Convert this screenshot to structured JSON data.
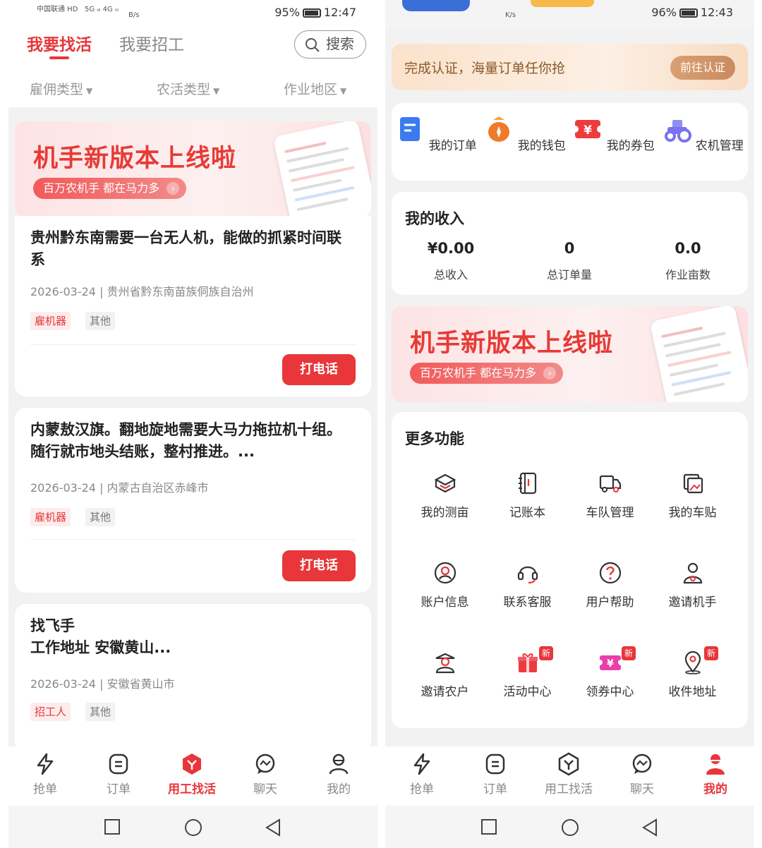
{
  "left": {
    "status": {
      "carrier": "中国联通 HD",
      "signal": "5G ᵢₗₗ 4G ᵢₗₗ",
      "speed": "B/s",
      "battery": "95%",
      "time": "12:47"
    },
    "tabs": {
      "find_work": "我要找活",
      "hire": "我要招工"
    },
    "search_label": "搜索",
    "filters": [
      "雇佣类型",
      "农活类型",
      "作业地区"
    ],
    "banner": {
      "title": "机手新版本上线啦",
      "subtitle": "百万农机手 都在马力多"
    },
    "jobs": [
      {
        "title": "贵州黔东南需要一台无人机，能做的抓紧时间联系",
        "meta": "2026-03-24 | 贵州省黔东南苗族侗族自治州",
        "tag1": "雇机器",
        "tag2": "其他",
        "action": "打电话"
      },
      {
        "title": "内蒙敖汉旗。翻地旋地需要大马力拖拉机十组。随行就市地头结账，整村推进。...",
        "meta": "2026-03-24 | 内蒙古自治区赤峰市",
        "tag1": "雇机器",
        "tag2": "其他",
        "action": "打电话"
      },
      {
        "title": "找飞手\n工作地址 安徽黄山...",
        "meta": "2026-03-24 | 安徽省黄山市",
        "tag1": "招工人",
        "tag2": "其他"
      }
    ],
    "nav": [
      {
        "label": "抢单",
        "icon": "lightning-icon"
      },
      {
        "label": "订单",
        "icon": "order-icon"
      },
      {
        "label": "用工找活",
        "icon": "work-icon",
        "active": true
      },
      {
        "label": "聊天",
        "icon": "chat-icon"
      },
      {
        "label": "我的",
        "icon": "profile-icon"
      }
    ]
  },
  "right": {
    "status": {
      "speed": "K/s",
      "battery": "96%",
      "time": "12:43"
    },
    "verify": {
      "text": "完成认证，海量订单任你抢",
      "button": "前往认证"
    },
    "quick": [
      {
        "label": "我的订单",
        "icon": "order-doc-icon"
      },
      {
        "label": "我的钱包",
        "icon": "wallet-icon"
      },
      {
        "label": "我的券包",
        "icon": "coupon-icon"
      },
      {
        "label": "农机管理",
        "icon": "tractor-icon"
      }
    ],
    "income": {
      "title": "我的收入",
      "items": [
        {
          "value": "¥0.00",
          "label": "总收入"
        },
        {
          "value": "0",
          "label": "总订单量"
        },
        {
          "value": "0.0",
          "label": "作业亩数"
        }
      ]
    },
    "banner": {
      "title": "机手新版本上线啦",
      "subtitle": "百万农机手 都在马力多"
    },
    "more": {
      "title": "更多功能",
      "new_label": "新",
      "items": [
        {
          "label": "我的测亩",
          "icon": "measure-icon"
        },
        {
          "label": "记账本",
          "icon": "ledger-icon"
        },
        {
          "label": "车队管理",
          "icon": "fleet-icon"
        },
        {
          "label": "我的车贴",
          "icon": "sticker-icon"
        },
        {
          "label": "账户信息",
          "icon": "account-icon"
        },
        {
          "label": "联系客服",
          "icon": "headset-icon"
        },
        {
          "label": "用户帮助",
          "icon": "help-icon"
        },
        {
          "label": "邀请机手",
          "icon": "invite-driver-icon"
        },
        {
          "label": "邀请农户",
          "icon": "invite-farmer-icon"
        },
        {
          "label": "活动中心",
          "icon": "gift-icon",
          "new": true
        },
        {
          "label": "领券中心",
          "icon": "coupon-center-icon",
          "new": true
        },
        {
          "label": "收件地址",
          "icon": "location-icon",
          "new": true
        }
      ]
    },
    "nav": [
      {
        "label": "抢单",
        "icon": "lightning-icon"
      },
      {
        "label": "订单",
        "icon": "order-icon"
      },
      {
        "label": "用工找活",
        "icon": "work-icon"
      },
      {
        "label": "聊天",
        "icon": "chat-icon"
      },
      {
        "label": "我的",
        "icon": "profile-icon",
        "active": true
      }
    ]
  },
  "colors": {
    "accent": "#e8363a",
    "verify_bg": "#fbe2cc",
    "verify_btn": "#c98b5e",
    "muted": "#888888"
  }
}
